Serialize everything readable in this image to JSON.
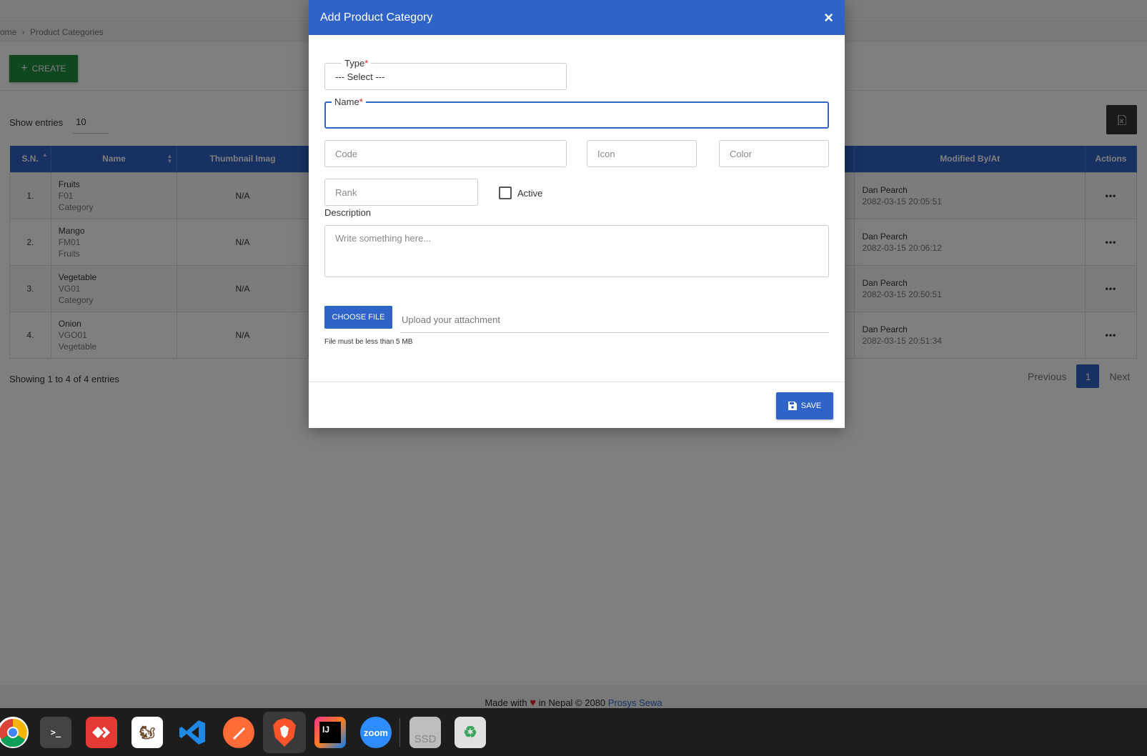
{
  "breadcrumb": {
    "home": "ome",
    "separator": "›",
    "current": "Product Categories"
  },
  "toolbar": {
    "create_label": "CREATE"
  },
  "entries": {
    "label": "Show entries",
    "value": "10"
  },
  "table": {
    "headers": {
      "sn": "S.N.",
      "name": "Name",
      "thumbnail": "Thumbnail Imag",
      "modified": "Modified By/At",
      "actions": "Actions"
    },
    "rows": [
      {
        "sn": "1.",
        "name": "Fruits",
        "code": "F01",
        "parent": "Category",
        "thumb": "N/A",
        "modified_by": "Dan Pearch",
        "modified_at": "2082-03-15 20:05:51",
        "actions": "•••"
      },
      {
        "sn": "2.",
        "name": "Mango",
        "code": "FM01",
        "parent": "Fruits",
        "thumb": "N/A",
        "modified_by": "Dan Pearch",
        "modified_at": "2082-03-15 20:06:12",
        "actions": "•••"
      },
      {
        "sn": "3.",
        "name": "Vegetable",
        "code": "VG01",
        "parent": "Category",
        "thumb": "N/A",
        "modified_by": "Dan Pearch",
        "modified_at": "2082-03-15 20:50:51",
        "actions": "•••"
      },
      {
        "sn": "4.",
        "name": "Onion",
        "code": "VGO01",
        "parent": "Vegetable",
        "thumb": "N/A",
        "modified_by": "Dan Pearch",
        "modified_at": "2082-03-15 20:51:34",
        "actions": "•••"
      }
    ]
  },
  "showing": "Showing 1 to 4 of 4 entries",
  "pagination": {
    "previous": "Previous",
    "current": "1",
    "next": "Next"
  },
  "footer": {
    "made_with": "Made with",
    "in_nepal": "in Nepal © 2080",
    "brand": "Prosys Sewa"
  },
  "modal": {
    "title": "Add Product Category",
    "close": "×",
    "type_label": "Type",
    "type_value": "--- Select ---",
    "name_label": "Name",
    "required_mark": "*",
    "code_placeholder": "Code",
    "icon_placeholder": "Icon",
    "color_placeholder": "Color",
    "rank_placeholder": "Rank",
    "active_label": "Active",
    "description_label": "Description",
    "description_placeholder": "Write something here...",
    "choose_file": "CHOOSE FILE",
    "upload_placeholder": "Upload your attachment",
    "file_hint": "File must be less than 5 MB",
    "save": "SAVE"
  },
  "taskbar": {
    "apps": [
      "chrome-icon",
      "terminal-icon",
      "anydesk-icon",
      "dbeaver-icon",
      "vscode-icon",
      "postman-icon",
      "brave-icon",
      "intellij-icon",
      "zoom-icon",
      "ssd-drive-icon",
      "trash-icon"
    ],
    "zoom_label": "zoom",
    "intellij_label": "IJ",
    "ssd_label": "SSD",
    "terminal_label": ">_"
  },
  "colors": {
    "primary": "#2f63c7",
    "create": "#1e8e3e",
    "overlay": "rgba(0,0,0,0.5)"
  }
}
